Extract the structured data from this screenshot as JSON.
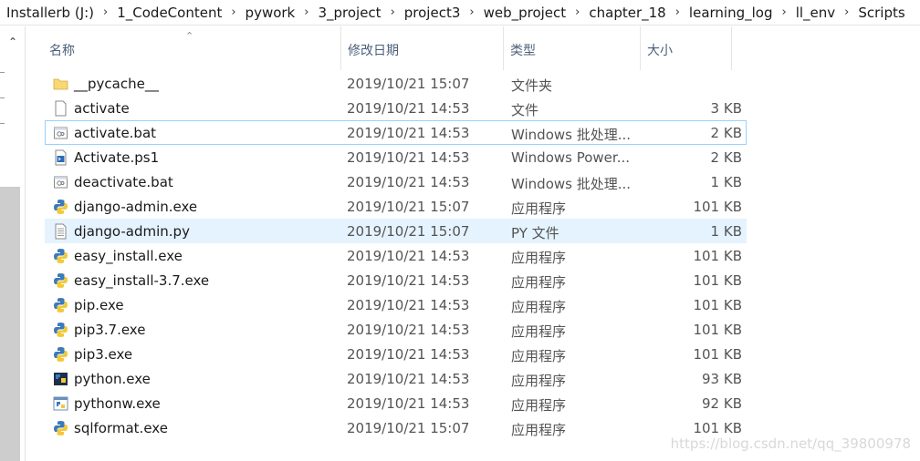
{
  "breadcrumb": [
    "Installerb (J:)",
    "1_CodeContent",
    "pywork",
    "3_project",
    "project3",
    "web_project",
    "chapter_18",
    "learning_log",
    "ll_env",
    "Scripts"
  ],
  "columns": {
    "name": "名称",
    "date": "修改日期",
    "type": "类型",
    "size": "大小"
  },
  "files": [
    {
      "name": "__pycache__",
      "date": "2019/10/21 15:07",
      "type": "文件夹",
      "size": "",
      "icon": "folder-icon"
    },
    {
      "name": "activate",
      "date": "2019/10/21 14:53",
      "type": "文件",
      "size": "3 KB",
      "icon": "file-icon"
    },
    {
      "name": "activate.bat",
      "date": "2019/10/21 14:53",
      "type": "Windows 批处理...",
      "size": "2 KB",
      "icon": "batch-file-icon"
    },
    {
      "name": "Activate.ps1",
      "date": "2019/10/21 14:53",
      "type": "Windows Power...",
      "size": "2 KB",
      "icon": "powershell-file-icon"
    },
    {
      "name": "deactivate.bat",
      "date": "2019/10/21 14:53",
      "type": "Windows 批处理...",
      "size": "1 KB",
      "icon": "batch-file-icon"
    },
    {
      "name": "django-admin.exe",
      "date": "2019/10/21 15:07",
      "type": "应用程序",
      "size": "101 KB",
      "icon": "python-exe-icon"
    },
    {
      "name": "django-admin.py",
      "date": "2019/10/21 15:07",
      "type": "PY 文件",
      "size": "1 KB",
      "icon": "text-file-icon"
    },
    {
      "name": "easy_install.exe",
      "date": "2019/10/21 14:53",
      "type": "应用程序",
      "size": "101 KB",
      "icon": "python-exe-icon"
    },
    {
      "name": "easy_install-3.7.exe",
      "date": "2019/10/21 14:53",
      "type": "应用程序",
      "size": "101 KB",
      "icon": "python-exe-icon"
    },
    {
      "name": "pip.exe",
      "date": "2019/10/21 14:53",
      "type": "应用程序",
      "size": "101 KB",
      "icon": "python-exe-icon"
    },
    {
      "name": "pip3.7.exe",
      "date": "2019/10/21 14:53",
      "type": "应用程序",
      "size": "101 KB",
      "icon": "python-exe-icon"
    },
    {
      "name": "pip3.exe",
      "date": "2019/10/21 14:53",
      "type": "应用程序",
      "size": "101 KB",
      "icon": "python-exe-icon"
    },
    {
      "name": "python.exe",
      "date": "2019/10/21 14:53",
      "type": "应用程序",
      "size": "93 KB",
      "icon": "python-console-icon"
    },
    {
      "name": "pythonw.exe",
      "date": "2019/10/21 14:53",
      "type": "应用程序",
      "size": "92 KB",
      "icon": "python-window-icon"
    },
    {
      "name": "sqlformat.exe",
      "date": "2019/10/21 15:07",
      "type": "应用程序",
      "size": "101 KB",
      "icon": "python-exe-icon"
    }
  ],
  "watermark": "https://blog.csdn.net/qq_39800978"
}
